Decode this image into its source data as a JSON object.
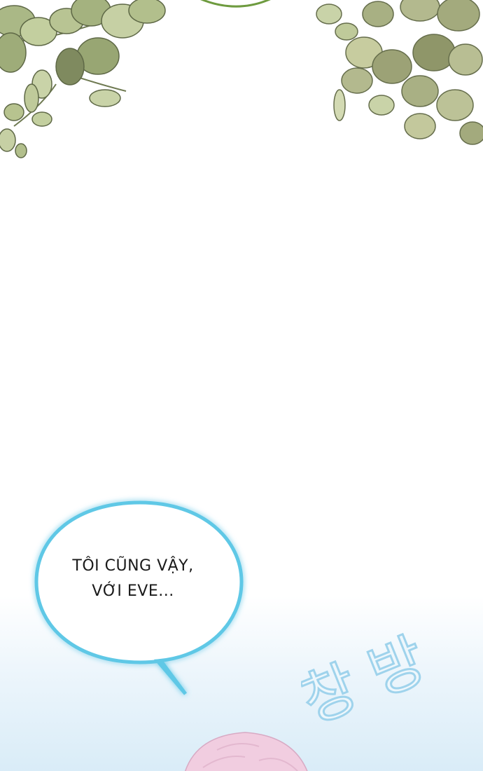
{
  "dialogue": {
    "line1": "TÔI CŨNG VẬY,",
    "line2": "VỚI EVE..."
  },
  "sound_effect": {
    "text": "창 방",
    "color": "#bfe3f5"
  },
  "colors": {
    "leaf_light": "#c9d3a8",
    "leaf_mid": "#a9b885",
    "leaf_dark": "#7f8a5f",
    "bubble_glow": "#5ec8e6",
    "hair_pink": "#f1cde0"
  }
}
